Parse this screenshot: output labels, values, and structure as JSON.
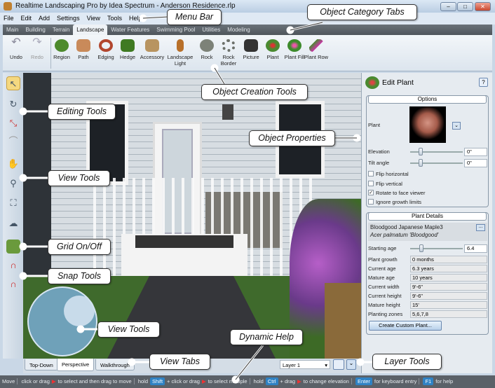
{
  "window": {
    "title": "Realtime Landscaping Pro by Idea Spectrum - Anderson Residence.rlp",
    "minimize": "‒",
    "maximize": "□",
    "close": "✕"
  },
  "menu": [
    "File",
    "Edit",
    "Add",
    "Settings",
    "View",
    "Tools",
    "Help"
  ],
  "category_tabs": {
    "items": [
      "Main",
      "Building",
      "Terrain",
      "Landscape",
      "Water Features",
      "Swimming Pool",
      "Utilities",
      "Modeling"
    ],
    "active": "Landscape"
  },
  "toolbar": {
    "undo": "Undo",
    "redo": "Redo",
    "tools": [
      "Region",
      "Path",
      "Edging",
      "Hedge",
      "Accessory",
      "Landscape Light",
      "Rock",
      "Rock Border",
      "Picture",
      "Plant",
      "Plant Fill",
      "Plant Row"
    ]
  },
  "left_tools": [
    "select-arrow-icon",
    "rotate-icon",
    "resize-icon",
    "curve-icon",
    "pan-hand-icon",
    "zoom-icon",
    "zoom-extents-icon",
    "orbit-icon",
    "grid-icon",
    "snap-magnet-icon",
    "snap-options-icon"
  ],
  "panel": {
    "title": "Edit Plant",
    "help": "?",
    "options_header": "Options",
    "plant_label": "Plant",
    "elevation_label": "Elevation",
    "elevation": "0\"",
    "tilt_label": "Tilt angle",
    "tilt": "0\"",
    "checkboxes": [
      {
        "label": "Flip horizontal",
        "checked": false
      },
      {
        "label": "Flip vertical",
        "checked": false
      },
      {
        "label": "Rotate to face viewer",
        "checked": true
      },
      {
        "label": "Ignore growth limits",
        "checked": false
      }
    ],
    "details_header": "Plant Details",
    "plant_name": "Bloodgood Japanese Maple3",
    "botanical": "Acer palmatum 'Bloodgood'",
    "browse": "...",
    "starting_age_label": "Starting age",
    "starting_age": "6.4",
    "rows": [
      {
        "label": "Plant growth",
        "value": "0 months"
      },
      {
        "label": "Current age",
        "value": "6.3 years"
      },
      {
        "label": "Mature age",
        "value": "10 years"
      },
      {
        "label": "Current width",
        "value": "9'-6\""
      },
      {
        "label": "Current height",
        "value": "9'-6\""
      },
      {
        "label": "Mature height",
        "value": "15'"
      },
      {
        "label": "Planting zones",
        "value": "5,6,7,8"
      }
    ],
    "custom_button": "Create Custom Plant..."
  },
  "view_tabs": {
    "items": [
      "Top-Down",
      "Perspective",
      "Walkthrough"
    ],
    "active": "Perspective"
  },
  "layer": {
    "selected": "Layer 1"
  },
  "status": {
    "mode": "Move",
    "t1": "click or drag",
    "t2": "to select and then drag to move",
    "hold1": "hold",
    "shift": "Shift",
    "t3": "+ click or drag",
    "t4": "to select multiple",
    "hold2": "hold",
    "ctrl": "Ctrl",
    "t5": "+ drag",
    "t6": "to change elevation",
    "enter": "Enter",
    "t7": "for keyboard entry",
    "f1": "F1",
    "t8": "for help"
  },
  "callouts": {
    "menu_bar": "Menu Bar",
    "category_tabs": "Object Category Tabs",
    "creation_tools": "Object Creation Tools",
    "editing_tools": "Editing Tools",
    "object_properties": "Object Properties",
    "view_tools_left": "View Tools",
    "grid": "Grid On/Off",
    "snap": "Snap Tools",
    "view_tools_nav": "View Tools",
    "dynamic_help": "Dynamic Help",
    "view_tabs": "View Tabs",
    "layer_tools": "Layer Tools"
  }
}
